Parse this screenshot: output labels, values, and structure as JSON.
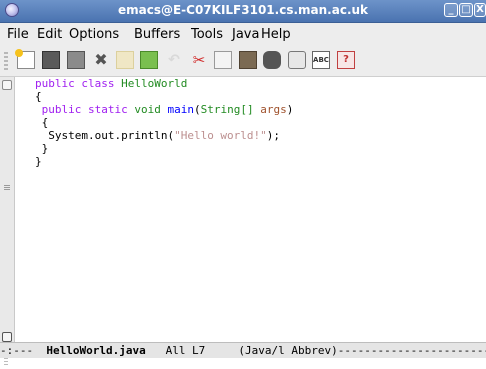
{
  "window": {
    "title": "emacs@E-C07KILF3101.cs.man.ac.uk",
    "buttons": {
      "minimize": "_",
      "maximize": "□",
      "close": "X"
    }
  },
  "menu": [
    "File",
    "Edit",
    "Options",
    "Buffers",
    "Tools",
    "Java",
    "Help"
  ],
  "toolbar": {
    "icons": [
      "new-file-icon",
      "open-folder-icon",
      "save-icon",
      "close-buffer-icon",
      "save-as-icon",
      "revert-icon",
      "undo-icon",
      "cut-icon",
      "copy-icon",
      "paste-icon",
      "search-icon",
      "print-icon",
      "customize-icon",
      "help-icon"
    ],
    "close_glyph": "✖",
    "undo_glyph": "↶",
    "cut_glyph": "✂",
    "custom_text": "ABC",
    "help_glyph": "?"
  },
  "code": {
    "l1": {
      "kw1": "public",
      "sp1": " ",
      "kw2": "class",
      "sp2": " ",
      "name": "HelloWorld"
    },
    "l2": "{",
    "l3": {
      "indent": " ",
      "kw1": "public",
      "sp1": " ",
      "kw2": "static",
      "sp2": " ",
      "ty": "void",
      "sp3": " ",
      "fn": "main",
      "paren": "(",
      "argt": "String[]",
      "sp4": " ",
      "arg": "args",
      "end": ")"
    },
    "l4": " {",
    "l5": {
      "pre": "  System.out.println(",
      "str": "\"Hello world!\"",
      "post": ");"
    },
    "l6": " }",
    "l7": "}"
  },
  "modeline": {
    "prefix": "-:---  ",
    "buffer": "HelloWorld.java",
    "position": "   All L7     ",
    "mode": "(Java/l Abbrev)",
    "fill": "---------------------------"
  }
}
